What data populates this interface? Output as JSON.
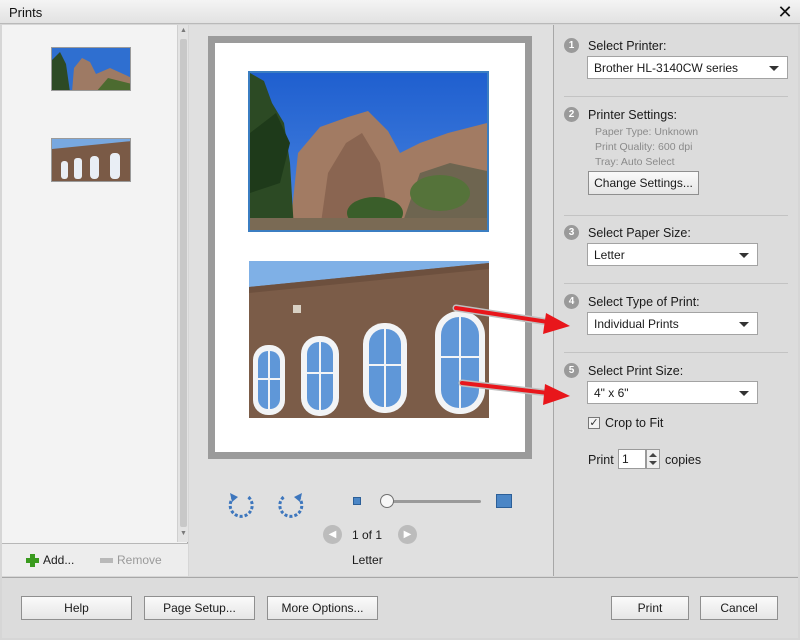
{
  "window": {
    "title": "Prints"
  },
  "thumbnails": [
    {
      "name": "Cliff photo thumbnail"
    },
    {
      "name": "Adobe wall with windows thumbnail"
    }
  ],
  "thumb_footer": {
    "add_label": "Add...",
    "remove_label": "Remove"
  },
  "preview": {
    "page_count": "1 of 1",
    "paper_label": "Letter"
  },
  "settings": {
    "step1": {
      "num": "1",
      "title": "Select Printer:",
      "value": "Brother HL-3140CW series"
    },
    "step2": {
      "num": "2",
      "title": "Printer Settings:",
      "paper_type": "Paper Type: Unknown",
      "print_quality": "Print Quality: 600 dpi",
      "tray": "Tray: Auto Select",
      "change_button": "Change Settings..."
    },
    "step3": {
      "num": "3",
      "title": "Select Paper Size:",
      "value": "Letter"
    },
    "step4": {
      "num": "4",
      "title": "Select Type of Print:",
      "value": "Individual Prints"
    },
    "step5": {
      "num": "5",
      "title": "Select Print Size:",
      "value": "4\" x 6\"",
      "crop_label": "Crop to Fit",
      "crop_checked": true,
      "print_label": "Print",
      "copies_value": "1",
      "copies_label": "copies"
    }
  },
  "buttons": {
    "help": "Help",
    "page_setup": "Page Setup...",
    "more_options": "More Options...",
    "print": "Print",
    "cancel": "Cancel"
  },
  "colors": {
    "accent": "#3b7ec2",
    "annotation_arrow": "#e8161b"
  }
}
